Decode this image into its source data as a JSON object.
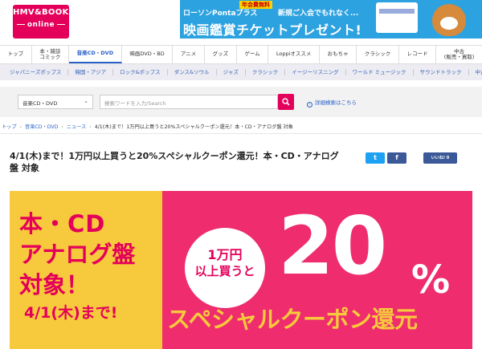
{
  "header": {
    "logo_line1": "HMV&BOOKS",
    "logo_line2": "online",
    "banner": {
      "ribbon": "年会費無料",
      "line1a": "ローソンPontaプラス",
      "line1b": "新規ご入会でもれなく...",
      "line2": "映画鑑賞チケットプレゼント!"
    }
  },
  "nav": {
    "items": [
      {
        "label": "トップ"
      },
      {
        "label": "本・雑誌\nコミック"
      },
      {
        "label": "音楽CD・DVD",
        "active": true
      },
      {
        "label": "映画DVD・BD"
      },
      {
        "label": "アニメ"
      },
      {
        "label": "グッズ"
      },
      {
        "label": "ゲーム"
      },
      {
        "label": "Loppiオススメ"
      },
      {
        "label": "おもちゃ"
      },
      {
        "label": "クラシック"
      },
      {
        "label": "レコード"
      },
      {
        "label": "中古\n(販売・買取)"
      }
    ]
  },
  "subnav": {
    "items": [
      "ジャパニーズポップス",
      "韓国・アジア",
      "ロック&ポップス",
      "ダンス&ソウル",
      "ジャズ",
      "クラシック",
      "イージーリスニング",
      "ワールド ミュージック",
      "サウンドトラック",
      "中古"
    ]
  },
  "search": {
    "category_selected": "音楽CD・DVD",
    "placeholder": "検索ワードを入力/Search",
    "detail_link": "詳細検索はこちら"
  },
  "breadcrumb": {
    "items": [
      "トップ",
      "音楽CD・DVD",
      "ニュース"
    ],
    "current": "4/1(木)まで！1万円以上買うと20%スペシャルクーポン還元！本・CD・アナログ盤 対象"
  },
  "article": {
    "title": "4/1(木)まで！1万円以上買うと20%スペシャルクーポン還元！本・CD・アナログ盤 対象",
    "share": {
      "twitter": "t",
      "facebook": "f",
      "like": "いいね! 0"
    }
  },
  "hero": {
    "left_line1": "本・CD",
    "left_line2": "アナログ盤",
    "left_line3": "対象！",
    "left_date": "4/1(木)まで!",
    "circle_line1": "1万円",
    "circle_line2": "以上買うと",
    "big_number": "20",
    "percent": "%",
    "bottom": "スペシャルクーポン還元"
  },
  "colors": {
    "brand": "#e4005a",
    "hero_yellow": "#f7c93c",
    "hero_pink": "#ee2c6e",
    "banner_blue": "#2da2e0",
    "link_blue": "#2a62c8"
  }
}
